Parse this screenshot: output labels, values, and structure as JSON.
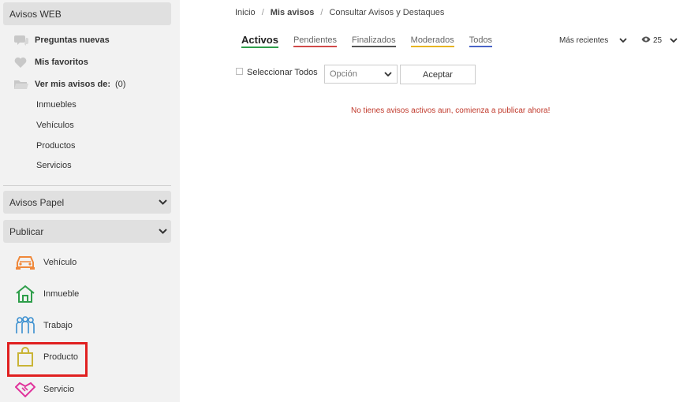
{
  "sidebar": {
    "avisos_web": {
      "title": "Avisos WEB",
      "items": [
        {
          "label": "Preguntas nuevas",
          "icon": "chat-icon"
        },
        {
          "label": "Mis favoritos",
          "icon": "heart-icon"
        },
        {
          "label": "Ver mis avisos de:",
          "count": "(0)",
          "icon": "folder-icon"
        }
      ],
      "sub_items": [
        "Inmuebles",
        "Vehículos",
        "Productos",
        "Servicios"
      ]
    },
    "avisos_papel": {
      "title": "Avisos Papel"
    },
    "publicar": {
      "title": "Publicar",
      "items": [
        {
          "label": "Vehículo",
          "icon": "car-icon",
          "color": "#f0883a"
        },
        {
          "label": "Inmueble",
          "icon": "house-icon",
          "color": "#2e9e4a"
        },
        {
          "label": "Trabajo",
          "icon": "people-icon",
          "color": "#3a8fd0"
        },
        {
          "label": "Producto",
          "icon": "shopping-bag-icon",
          "color": "#c9b436"
        },
        {
          "label": "Servicio",
          "icon": "handshake-icon",
          "color": "#e0329b"
        }
      ]
    }
  },
  "breadcrumb": {
    "home": "Inicio",
    "current": "Mis avisos",
    "page": "Consultar Avisos y Destaques"
  },
  "tabs": [
    "Activos",
    "Pendientes",
    "Finalizados",
    "Moderados",
    "Todos"
  ],
  "sort": {
    "label": "Más recientes"
  },
  "views": {
    "count": "25"
  },
  "bulk": {
    "select_all": "Seleccionar Todos",
    "option_placeholder": "Opción",
    "accept": "Aceptar"
  },
  "empty_message": "No tienes avisos activos aun, comienza a publicar ahora!"
}
